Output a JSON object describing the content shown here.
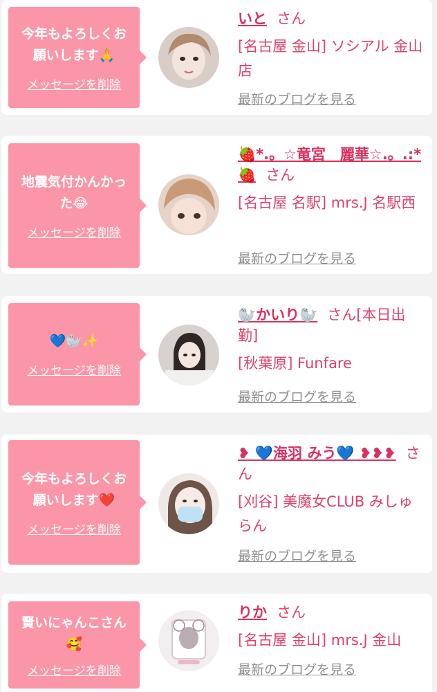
{
  "delete_label": "メッセージを削除",
  "blog_label": "最新のブログを見る",
  "cards": [
    {
      "message": "今年もよろしくお願いします🙏",
      "name": "いと",
      "honorific": "さん",
      "shop": "[名古屋 金山] ソシアル 金山店"
    },
    {
      "message": "地震気付かんかった😂",
      "name": "🍓*.。☆竜宮　麗華☆.。.:*🍓",
      "honorific": "さん",
      "shop": "[名古屋 名駅] mrs.J 名駅西"
    },
    {
      "message": "💙🦭✨",
      "name": "🦭かいり🦭",
      "honorific": "さん[本日出勤]",
      "shop": "[秋葉原] Funfare"
    },
    {
      "message": "今年もよろしくお願いします❤️",
      "name": "❥ 💙海羽 みう💙 ❥❥❥",
      "honorific": "さん",
      "shop": "[刈谷] 美魔女CLUB みしゅらん"
    },
    {
      "message": "賢いにゃんこさん🥰",
      "name": "りか",
      "honorific": "さん",
      "shop": "[名古屋 金山] mrs.J 金山"
    }
  ],
  "colors": {
    "bubble": "#fb96a8",
    "name": "#d8325e",
    "text": "#e0406a",
    "blog": "#8f8f8f",
    "background": "#f2f2f2"
  }
}
